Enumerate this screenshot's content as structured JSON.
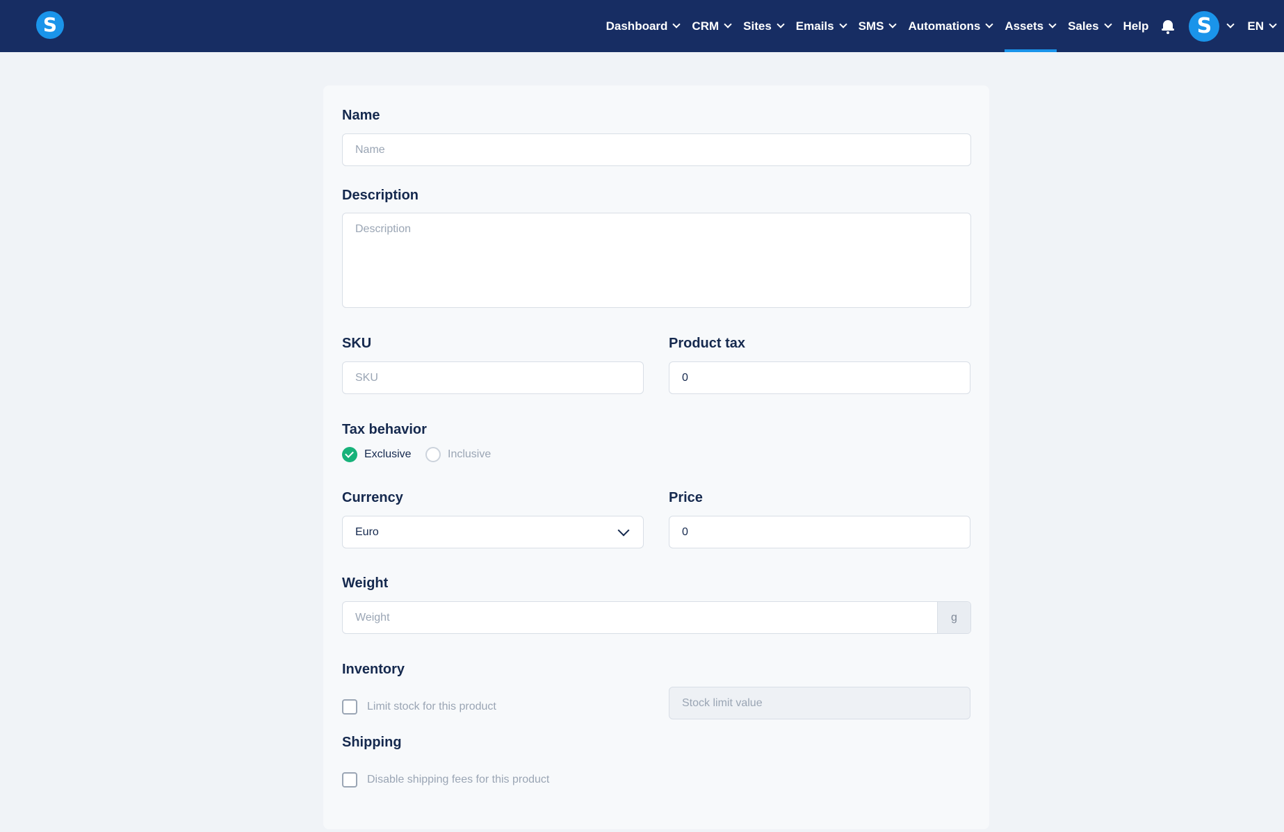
{
  "brand": {
    "logo_letter": "S",
    "accent": "#1a94ea",
    "nav_bg": "#172d63"
  },
  "nav": {
    "items": [
      {
        "label": "Dashboard"
      },
      {
        "label": "CRM"
      },
      {
        "label": "Sites"
      },
      {
        "label": "Emails"
      },
      {
        "label": "SMS"
      },
      {
        "label": "Automations"
      },
      {
        "label": "Assets",
        "active": true
      },
      {
        "label": "Sales"
      }
    ],
    "help_label": "Help",
    "bell_icon": "bell-icon",
    "avatar_letter": "S",
    "language": "EN"
  },
  "form": {
    "name": {
      "label": "Name",
      "placeholder": "Name",
      "value": ""
    },
    "description": {
      "label": "Description",
      "placeholder": "Description",
      "value": ""
    },
    "sku": {
      "label": "SKU",
      "placeholder": "SKU",
      "value": ""
    },
    "product_tax": {
      "label": "Product tax",
      "value": "0"
    },
    "tax_behavior": {
      "label": "Tax behavior",
      "options": [
        "Exclusive",
        "Inclusive"
      ],
      "selected": "Exclusive",
      "selected_color": "#17b27a"
    },
    "currency": {
      "label": "Currency",
      "value": "Euro"
    },
    "price": {
      "label": "Price",
      "value": "0"
    },
    "weight": {
      "label": "Weight",
      "placeholder": "Weight",
      "unit": "g",
      "value": ""
    },
    "inventory": {
      "label": "Inventory",
      "checkbox_label": "Limit stock for this product",
      "checked": false,
      "stock_placeholder": "Stock limit value"
    },
    "shipping": {
      "label": "Shipping",
      "checkbox_label": "Disable shipping fees for this product",
      "checked": false
    }
  }
}
